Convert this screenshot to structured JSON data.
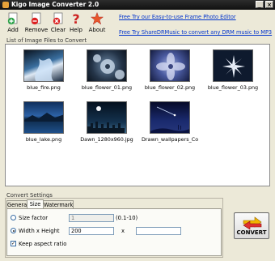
{
  "window": {
    "title": "Kigo Image Converter 2.0"
  },
  "toolbar": {
    "add": "Add",
    "remove": "Remove",
    "clear": "Clear",
    "help": "Help",
    "about": "About"
  },
  "links": [
    "Free Try our Easy-to-use Frame Photo Editor",
    "Free Try ShareDRMusic to convert any DRM music to MP3"
  ],
  "list": {
    "label": "List of Image Files to Convert",
    "files": [
      "blue_fire.png",
      "blue_flower_01.png",
      "blue_flower_02.png",
      "blue_flower_03.png",
      "blue_lake.png",
      "Dawn_1280x960.jpg",
      "Drawn_wallpapers_Comet…"
    ]
  },
  "settings": {
    "label": "Convert Settings",
    "tabs": [
      "General",
      "Size",
      "Watermark"
    ],
    "active_tab": "Size",
    "size_factor_label": "Size factor",
    "size_factor_value": "1",
    "size_factor_range": "(0.1-10)",
    "width_height_label": "Width x Height",
    "width_value": "200",
    "x_label": "x",
    "height_value": "",
    "keep_aspect_label": "Keep aspect ratio",
    "keep_aspect_checked": true,
    "selected_mode": "width_height"
  },
  "convert": {
    "label": "CONVERT"
  },
  "icons": [
    "app-icon",
    "add-icon",
    "remove-icon",
    "clear-icon",
    "help-icon",
    "about-icon",
    "convert-icon"
  ],
  "colors": {
    "titlebar": "#1b1b1b",
    "link": "#0033cc",
    "add_green": "#2ea44a",
    "remove_red": "#d22",
    "help_red": "#cc2222",
    "about_orange": "#e8562a"
  }
}
